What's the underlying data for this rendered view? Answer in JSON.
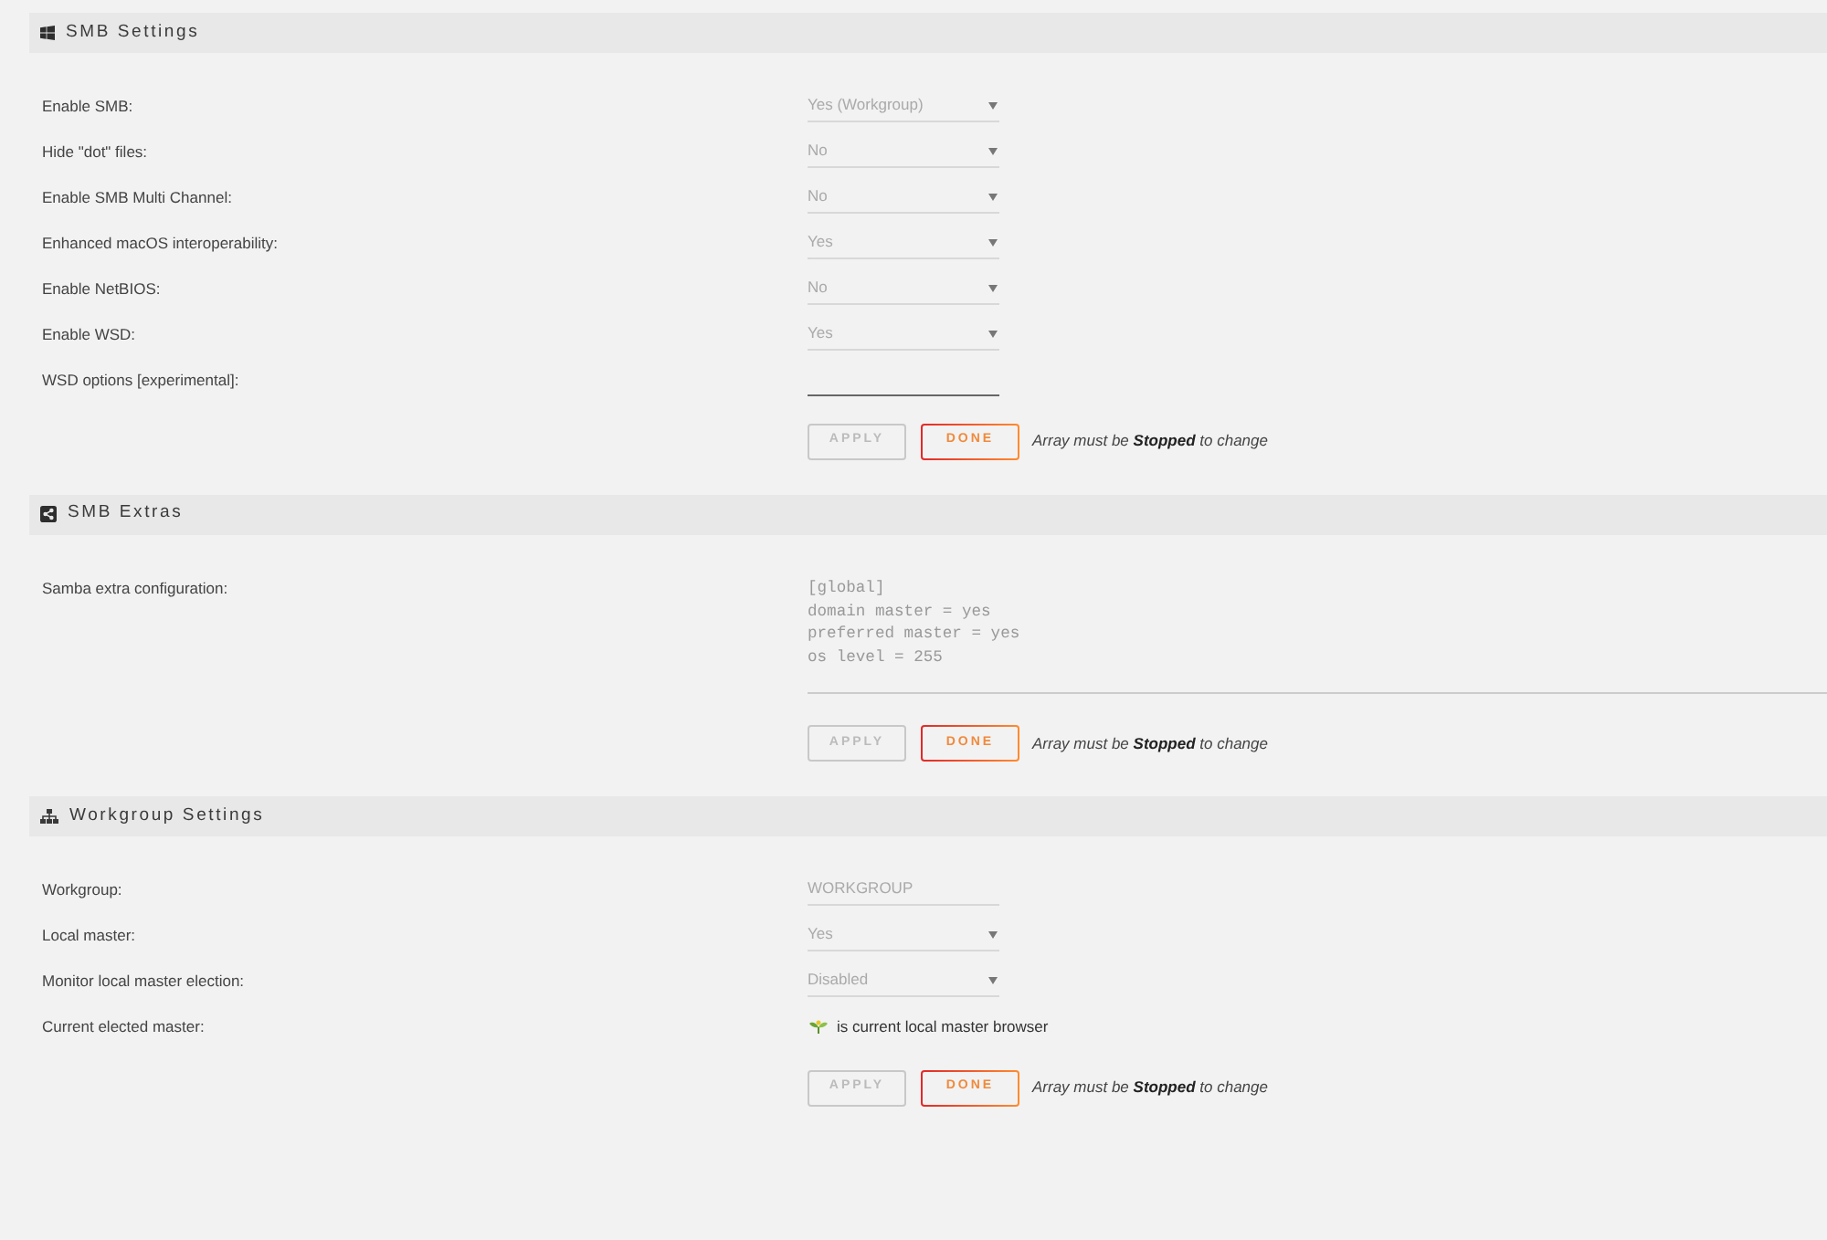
{
  "sections": [
    {
      "title": "SMB Settings",
      "rows": [
        {
          "kind": "select",
          "label": "Enable SMB:",
          "value": "Yes (Workgroup)",
          "disabled": true
        },
        {
          "kind": "select",
          "label": "Hide \"dot\" files:",
          "value": "No",
          "disabled": true
        },
        {
          "kind": "select",
          "label": "Enable SMB Multi Channel:",
          "value": "No",
          "disabled": true
        },
        {
          "kind": "select",
          "label": "Enhanced macOS interoperability:",
          "value": "Yes",
          "disabled": true
        },
        {
          "kind": "select",
          "label": "Enable NetBIOS:",
          "value": "No",
          "disabled": true
        },
        {
          "kind": "select",
          "label": "Enable WSD:",
          "value": "Yes",
          "disabled": true
        },
        {
          "kind": "input",
          "label": "WSD options [experimental]:",
          "disabled": false
        }
      ],
      "buttons": [
        {
          "label": "APPLY",
          "disabled": true
        },
        {
          "label": "DONE",
          "disabled": false
        }
      ],
      "note": "Array must be **Stopped** to change"
    },
    {
      "title": "SMB Extras",
      "rows": [
        {
          "kind": "textarea",
          "label": "Samba extra configuration:",
          "value": "[global]\ndomain master = yes\npreferred master = yes\nos level = 255",
          "disabled": true
        }
      ],
      "buttons": [
        {
          "label": "APPLY",
          "disabled": true
        },
        {
          "label": "DONE",
          "disabled": false
        }
      ],
      "note": "Array must be **Stopped** to change"
    },
    {
      "title": "Workgroup Settings",
      "rows": [
        {
          "kind": "input",
          "label": "Workgroup:",
          "value": "WORKGROUP",
          "disabled": true
        },
        {
          "kind": "select",
          "label": "Local master:",
          "value": "Yes",
          "disabled": true
        },
        {
          "kind": "select",
          "label": "Monitor local master election:",
          "value": "Disabled",
          "disabled": true
        },
        {
          "kind": "status",
          "label": "Current elected master:",
          "value": "is current local master browser"
        }
      ],
      "buttons": [
        {
          "label": "APPLY",
          "disabled": true
        },
        {
          "label": "DONE",
          "disabled": false
        }
      ],
      "note": "Array must be **Stopped** to change"
    }
  ]
}
